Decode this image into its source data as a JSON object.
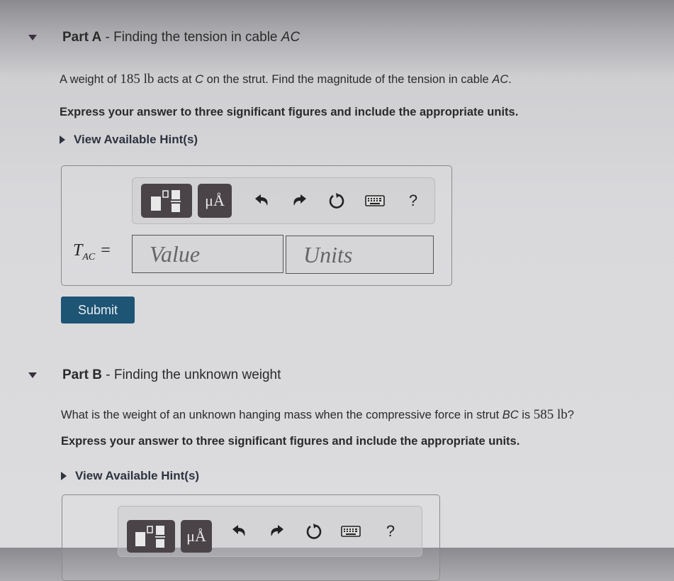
{
  "partA": {
    "label": "Part A",
    "separator": " - ",
    "title_prefix": "Finding the tension in cable ",
    "title_var": "AC",
    "problem": {
      "t1": "A weight of ",
      "weight": "185",
      "unit": "lb",
      "t2": " acts at ",
      "var1": "C",
      "t3": " on the strut. Find the magnitude of the tension in cable ",
      "var2": "AC",
      "t4": "."
    },
    "instruction": "Express your answer to three significant figures and include the appropriate units.",
    "hint_label": "View Available Hint(s)",
    "answer": {
      "variable": "T",
      "subscript": "AC",
      "equals": "=",
      "value_placeholder": "Value",
      "units_placeholder": "Units"
    },
    "toolbar": {
      "templates_icon": "fraction-template-icon",
      "units_label": "μÅ",
      "undo_icon": "undo-icon",
      "redo_icon": "redo-icon",
      "reset_icon": "reset-icon",
      "keyboard_icon": "keyboard-icon",
      "help_label": "?"
    },
    "submit_label": "Submit"
  },
  "partB": {
    "label": "Part B",
    "separator": " - ",
    "title": "Finding the unknown weight",
    "problem": {
      "t1": "What is the weight of an unknown hanging mass when the compressive force in strut ",
      "var1": "BC",
      "t2": " is ",
      "force": "585",
      "unit": "lb",
      "t3": "?"
    },
    "instruction": "Express your answer to three significant figures and include the appropriate units.",
    "hint_label": "View Available Hint(s)",
    "toolbar": {
      "units_label": "μÅ",
      "help_label": "?"
    }
  },
  "colors": {
    "submit_bg": "#1e5474",
    "toolbar_dark": "#4a4448"
  }
}
